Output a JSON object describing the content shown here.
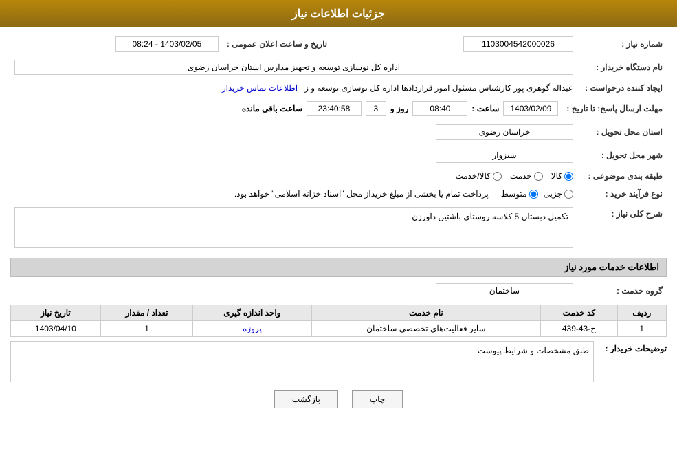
{
  "header": {
    "title": "جزئیات اطلاعات نیاز"
  },
  "fields": {
    "need_number_label": "شماره نیاز :",
    "need_number_value": "1103004542000026",
    "buyer_org_label": "نام دستگاه خریدار :",
    "buyer_org_value": "اداره کل نوسازی  توسعه و تجهیز مدارس استان خراسان رضوی",
    "requester_label": "ایجاد کننده درخواست :",
    "requester_value": "عبداله گوهری پور کارشناس مسئول امور قراردادها  اداره کل نوسازی  توسعه و ز",
    "requester_link": "اطلاعات تماس خریدار",
    "response_deadline_label": "مهلت ارسال پاسخ: تا تاریخ :",
    "response_date": "1403/02/09",
    "response_time_label": "ساعت :",
    "response_time": "08:40",
    "response_day_label": "روز و",
    "response_days": "3",
    "response_remaining_label": "ساعت باقی مانده",
    "response_remaining": "23:40:58",
    "province_label": "استان محل تحویل :",
    "province_value": "خراسان رضوی",
    "city_label": "شهر محل تحویل :",
    "city_value": "سبزوار",
    "category_label": "طبقه بندی موضوعی :",
    "category_options": [
      "کالا",
      "خدمت",
      "کالا/خدمت"
    ],
    "category_selected": "کالا",
    "process_label": "نوع فرآیند خرید :",
    "process_options": [
      "جزیی",
      "متوسط"
    ],
    "process_selected": "متوسط",
    "process_note": "پرداخت تمام یا بخشی از مبلغ خریداز محل \"اسناد خزانه اسلامی\" خواهد بود.",
    "announcement_date_label": "تاریخ و ساعت اعلان عمومی :",
    "announcement_date_value": "1403/02/05 - 08:24",
    "need_description_label": "شرح کلی نیاز :",
    "need_description_value": "تکمیل دبستان 5 کلاسه روستای باشتین داورزن",
    "services_section_title": "اطلاعات خدمات مورد نیاز",
    "service_group_label": "گروه خدمت :",
    "service_group_value": "ساختمان",
    "table_headers": [
      "ردیف",
      "کد خدمت",
      "نام خدمت",
      "واحد اندازه گیری",
      "تعداد / مقدار",
      "تاریخ نیاز"
    ],
    "table_rows": [
      {
        "row": "1",
        "code": "ج-43-439",
        "name": "سایر فعالیت‌های تخصصی ساختمان",
        "unit": "پروژه",
        "quantity": "1",
        "date": "1403/04/10"
      }
    ],
    "buyer_notes_label": "توضیحات خریدار :",
    "buyer_notes_value": "طبق مشخصات و شرایط پیوست",
    "btn_print": "چاپ",
    "btn_back": "بازگشت"
  }
}
